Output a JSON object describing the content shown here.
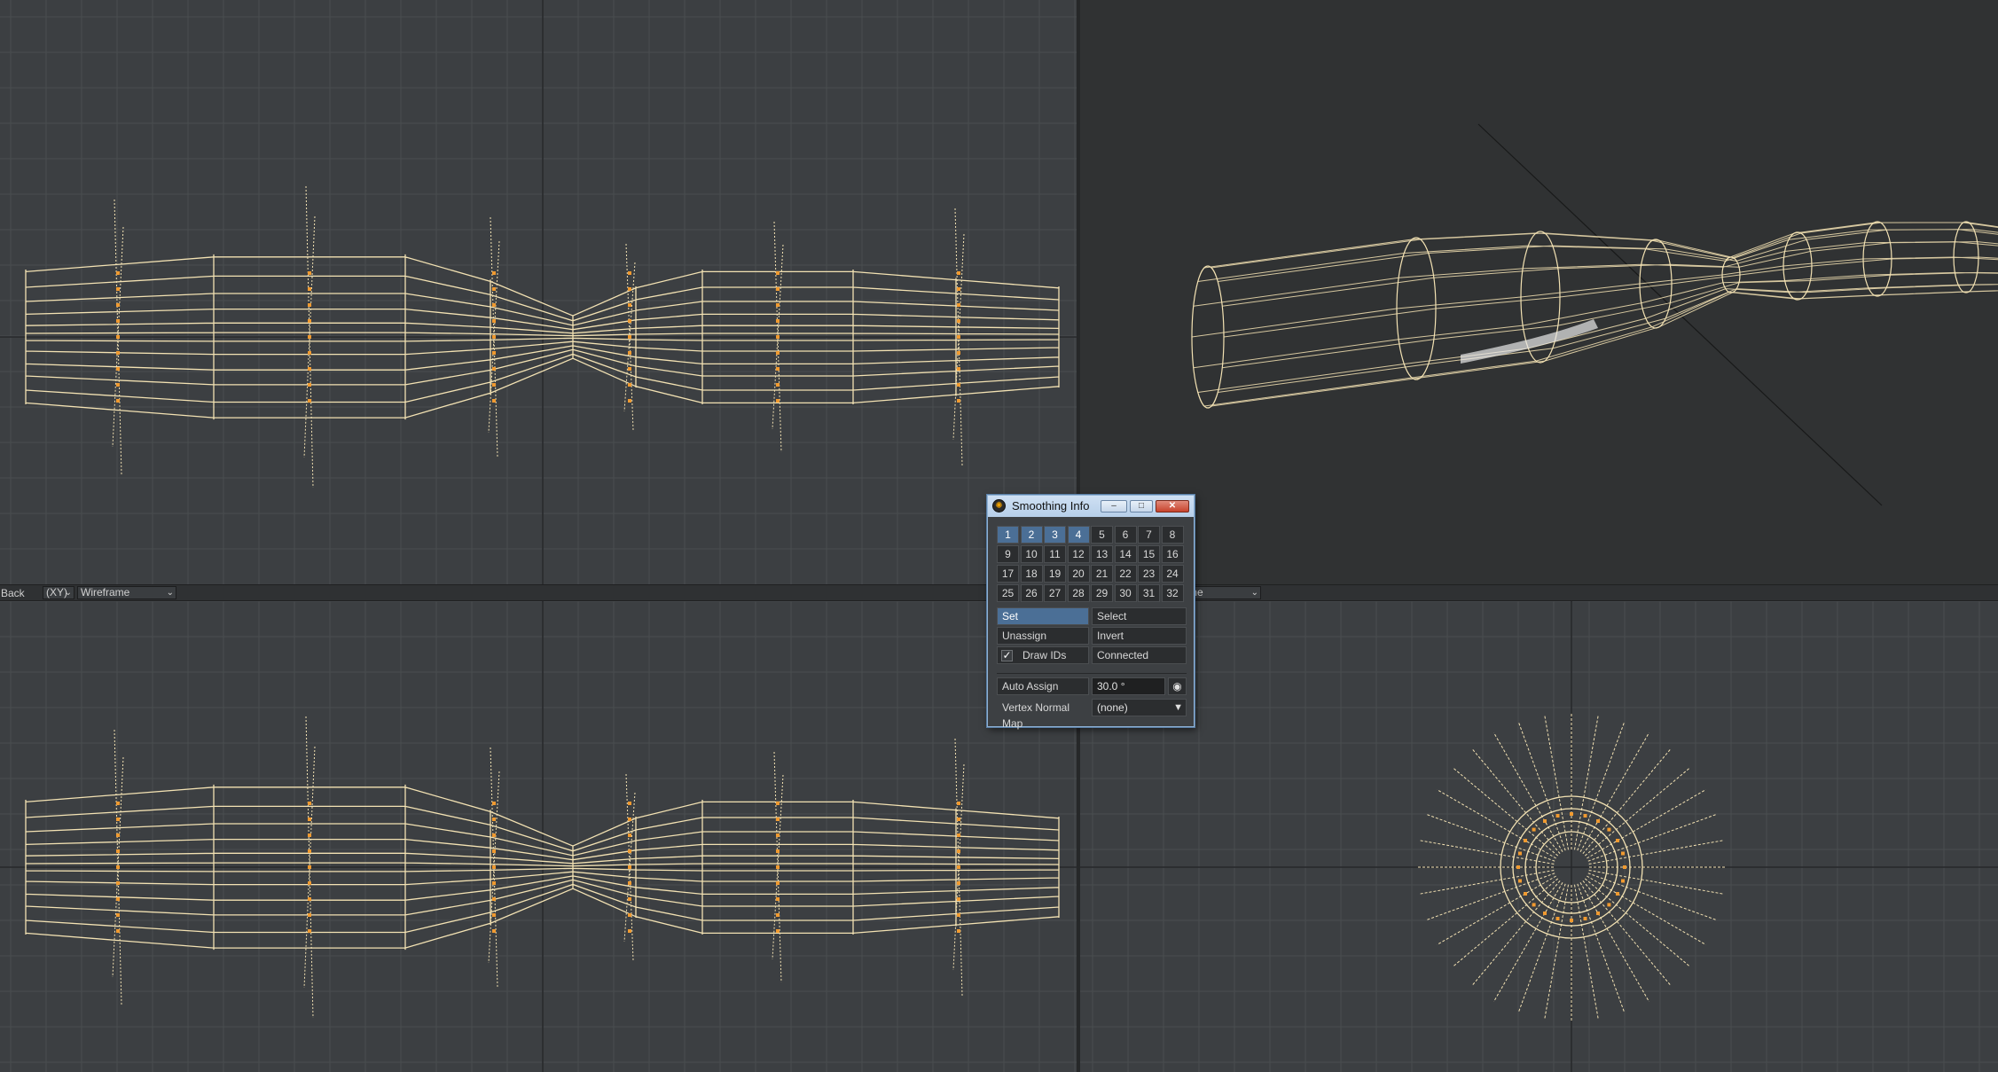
{
  "header_bar": {
    "view_label": "Back",
    "plane_select": "(XY)",
    "mode_select": "Wireframe",
    "right_mode_select": "me"
  },
  "dialog": {
    "title": "Smoothing Info",
    "window_buttons": {
      "minimize": "–",
      "maximize": "□",
      "close": "✕"
    },
    "id_cells": [
      "1",
      "2",
      "3",
      "4",
      "5",
      "6",
      "7",
      "8",
      "9",
      "10",
      "11",
      "12",
      "13",
      "14",
      "15",
      "16",
      "17",
      "18",
      "19",
      "20",
      "21",
      "22",
      "23",
      "24",
      "25",
      "26",
      "27",
      "28",
      "29",
      "30",
      "31",
      "32"
    ],
    "selected_ids": [
      "1",
      "2",
      "3",
      "4"
    ],
    "buttons": {
      "set": "Set",
      "select": "Select",
      "unassign": "Unassign",
      "invert": "Invert",
      "draw_ids": "Draw IDs",
      "connected": "Connected"
    },
    "draw_ids_checked": true,
    "auto_assign": {
      "label": "Auto Assign",
      "value": "30.0 °"
    },
    "vertex_normal_map": {
      "label": "Vertex Normal Map",
      "value": "(none)"
    }
  },
  "colors": {
    "viewport_bg": "#3c3f42",
    "perspective_bg": "#303233",
    "grid_line": "#4a4d50",
    "axis_line": "#26282a",
    "wireframe": "#f3e2b3",
    "id_label": "#f09a30",
    "dialog_title_bg": "#c4d8ee",
    "selected_cell": "#4b6f96"
  },
  "icons": {
    "app_icon": "lightwave-icon",
    "eye_icon": "eye-icon",
    "dropdown": "chevron-down-icon",
    "checkbox": "check-icon"
  }
}
